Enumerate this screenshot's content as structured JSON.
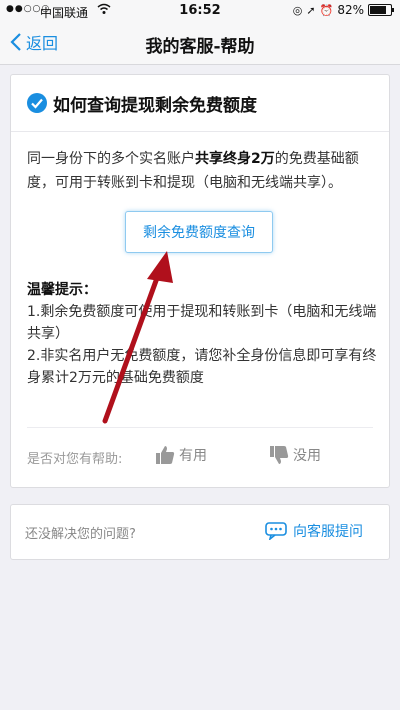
{
  "status_bar": {
    "carrier": "中国联通",
    "time": "16:52",
    "battery": "82%",
    "battery_level": 0.82
  },
  "nav": {
    "back_label": "返回",
    "title": "我的客服-帮助"
  },
  "question": {
    "title": "如何查询提现剩余免费额度",
    "intro_before": "同一身份下的多个实名账户",
    "intro_bold": "共享终身2万",
    "intro_after": "的免费基础额度，可用于转账到卡和提现（电脑和无线端共享）。",
    "query_button": "剩余免费额度查询",
    "tips_title": "温馨提示：",
    "tips": [
      "1.剩余免费额度可使用于提现和转账到卡（电脑和无线端共享）",
      "2.非实名用户无免费额度，请您补全身份信息即可享有终身累计2万元的基础免费额度"
    ]
  },
  "feedback": {
    "prompt": "是否对您有帮助:",
    "useful": "有用",
    "useless": "没用"
  },
  "ask": {
    "prompt": "还没解决您的问题?",
    "link": "向客服提问"
  },
  "colors": {
    "accent": "#1a8ee0",
    "arrow": "#b0101c"
  }
}
